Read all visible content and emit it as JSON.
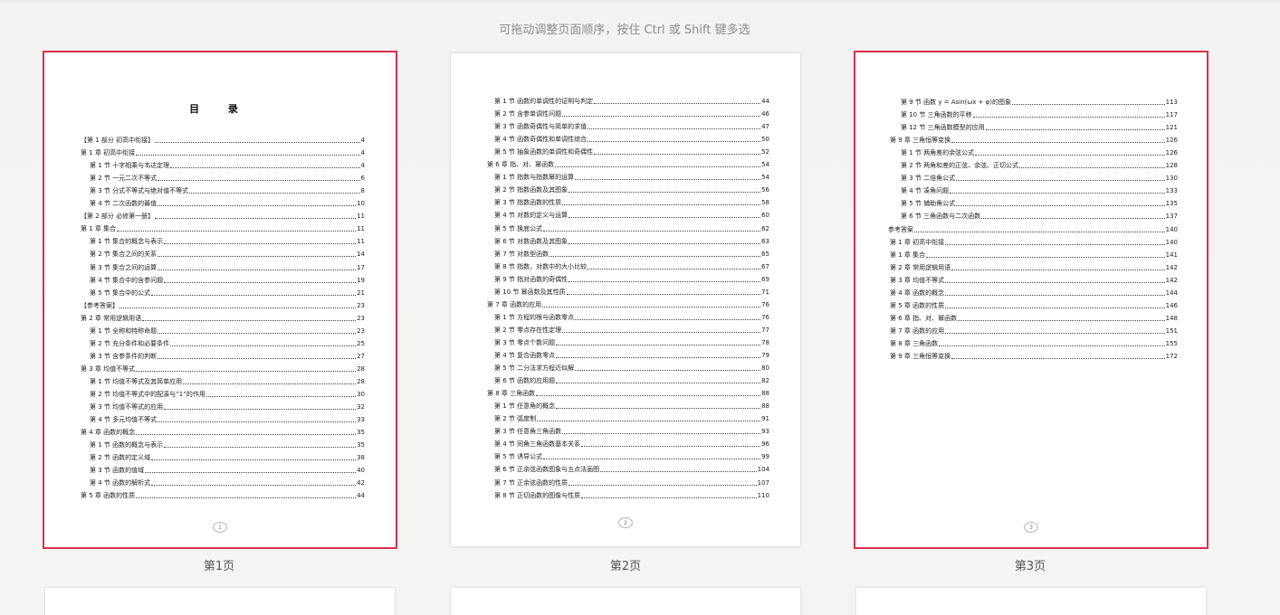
{
  "hint": "可拖动调整页面顺序，按住 Ctrl 或 Shift 键多选",
  "pages": [
    {
      "label": "第1页",
      "folio": "1",
      "title": "目 录",
      "rows": [
        {
          "t": "【第 1 部分 初高中衔接】",
          "n": "4",
          "lvl": 0
        },
        {
          "t": "第 1 章 初高中衔接",
          "n": "4",
          "lvl": 0
        },
        {
          "t": "第 1 节 十字相乘与韦达定理",
          "n": "4",
          "lvl": 1
        },
        {
          "t": "第 2 节 一元二次不等式",
          "n": "6",
          "lvl": 1
        },
        {
          "t": "第 3 节 分式不等式与绝对值不等式",
          "n": "8",
          "lvl": 1
        },
        {
          "t": "第 4 节 二次函数的最值",
          "n": "10",
          "lvl": 1
        },
        {
          "t": "【第 2 部分 必修第一册】",
          "n": "11",
          "lvl": 0
        },
        {
          "t": "第 1 章 集合",
          "n": "11",
          "lvl": 0
        },
        {
          "t": "第 1 节 集合的概念与表示",
          "n": "11",
          "lvl": 1
        },
        {
          "t": "第 2 节 集合之间的关系",
          "n": "14",
          "lvl": 1
        },
        {
          "t": "第 3 节 集合之间的运算",
          "n": "17",
          "lvl": 1
        },
        {
          "t": "第 4 节 集合中的含参问题",
          "n": "19",
          "lvl": 1
        },
        {
          "t": "第 5 节 集合中的公式",
          "n": "21",
          "lvl": 1
        },
        {
          "t": "【参考答案】",
          "n": "23",
          "lvl": 0
        },
        {
          "t": "第 2 章 常用逻辑用语",
          "n": "23",
          "lvl": 0
        },
        {
          "t": "第 1 节 全称和特称命题",
          "n": "23",
          "lvl": 1
        },
        {
          "t": "第 2 节 充分条件和必要条件",
          "n": "25",
          "lvl": 1
        },
        {
          "t": "第 3 节 含参条件的判断",
          "n": "27",
          "lvl": 1
        },
        {
          "t": "第 3 章 均值不等式",
          "n": "28",
          "lvl": 0
        },
        {
          "t": "第 1 节 均值不等式及其简单应用",
          "n": "28",
          "lvl": 1
        },
        {
          "t": "第 2 节 均值不等式中的配凑与“1”的作用",
          "n": "30",
          "lvl": 1
        },
        {
          "t": "第 3 节 均值不等式的应用",
          "n": "32",
          "lvl": 1
        },
        {
          "t": "第 4 节 多元均值不等式",
          "n": "33",
          "lvl": 1
        },
        {
          "t": "第 4 章 函数的概念",
          "n": "35",
          "lvl": 0
        },
        {
          "t": "第 1 节 函数的概念与表示",
          "n": "35",
          "lvl": 1
        },
        {
          "t": "第 2 节 函数的定义域",
          "n": "38",
          "lvl": 1
        },
        {
          "t": "第 3 节 函数的值域",
          "n": "40",
          "lvl": 1
        },
        {
          "t": "第 4 节 函数的解析式",
          "n": "42",
          "lvl": 1
        },
        {
          "t": "第 5 章 函数的性质",
          "n": "44",
          "lvl": 0
        }
      ]
    },
    {
      "label": "第2页",
      "folio": "2",
      "rows": [
        {
          "t": "第 1 节 函数的单调性的证明与判定",
          "n": "44",
          "lvl": 1
        },
        {
          "t": "第 2 节 含参单调性问题",
          "n": "46",
          "lvl": 1
        },
        {
          "t": "第 3 节 函数奇偶性与简单的求值",
          "n": "47",
          "lvl": 1
        },
        {
          "t": "第 4 节 函数奇偶性和单调性综合",
          "n": "50",
          "lvl": 1
        },
        {
          "t": "第 5 节 抽象函数的单调性和奇偶性",
          "n": "52",
          "lvl": 1
        },
        {
          "t": "第 6 章 指、对、幂函数",
          "n": "54",
          "lvl": 0
        },
        {
          "t": "第 1 节 指数与指数幂的运算",
          "n": "54",
          "lvl": 1
        },
        {
          "t": "第 2 节 指数函数及其图象",
          "n": "56",
          "lvl": 1
        },
        {
          "t": "第 3 节 指数函数的性质",
          "n": "58",
          "lvl": 1
        },
        {
          "t": "第 4 节 对数的定义与运算",
          "n": "60",
          "lvl": 1
        },
        {
          "t": "第 5 节 换底公式",
          "n": "62",
          "lvl": 1
        },
        {
          "t": "第 6 节 对数函数及其图象",
          "n": "63",
          "lvl": 1
        },
        {
          "t": "第 7 节 对数型函数",
          "n": "65",
          "lvl": 1
        },
        {
          "t": "第 8 节 指数、对数中的大小比较",
          "n": "67",
          "lvl": 1
        },
        {
          "t": "第 9 节 指对函数的奇偶性",
          "n": "69",
          "lvl": 1
        },
        {
          "t": "第 10 节 幂函数及其性质",
          "n": "71",
          "lvl": 1
        },
        {
          "t": "第 7 章 函数的应用",
          "n": "76",
          "lvl": 0
        },
        {
          "t": "第 1 节 方程的根与函数零点",
          "n": "76",
          "lvl": 1
        },
        {
          "t": "第 2 节 零点存在性定理",
          "n": "77",
          "lvl": 1
        },
        {
          "t": "第 3 节 零点个数问题",
          "n": "78",
          "lvl": 1
        },
        {
          "t": "第 4 节 复合函数零点",
          "n": "79",
          "lvl": 1
        },
        {
          "t": "第 5 节 二分法求方程近似解",
          "n": "80",
          "lvl": 1
        },
        {
          "t": "第 6 节 函数的应用题",
          "n": "82",
          "lvl": 1
        },
        {
          "t": "第 8 章 三角函数",
          "n": "88",
          "lvl": 0
        },
        {
          "t": "第 1 节 任意角的概念",
          "n": "88",
          "lvl": 1
        },
        {
          "t": "第 2 节 弧度制",
          "n": "91",
          "lvl": 1
        },
        {
          "t": "第 3 节 任意角三角函数",
          "n": "93",
          "lvl": 1
        },
        {
          "t": "第 4 节 同角三角函数基本关系",
          "n": "96",
          "lvl": 1
        },
        {
          "t": "第 5 节 诱导公式",
          "n": "99",
          "lvl": 1
        },
        {
          "t": "第 6 节 正余弦函数图象与五点法画图",
          "n": "104",
          "lvl": 1
        },
        {
          "t": "第 7 节 正余弦函数的性质",
          "n": "107",
          "lvl": 1
        },
        {
          "t": "第 8 节 正切函数的图像与性质",
          "n": "110",
          "lvl": 1
        }
      ]
    },
    {
      "label": "第3页",
      "folio": "3",
      "rows": [
        {
          "t": "第 9 节 函数 y = Asin(ωx + φ)的图象",
          "n": "113",
          "lvl": 1
        },
        {
          "t": "第 10 节 三角函数的平移",
          "n": "117",
          "lvl": 1
        },
        {
          "t": "第 12 节 三角函数模型的应用",
          "n": "121",
          "lvl": 1
        },
        {
          "t": "第 9 章 三角恒等变换",
          "n": "126",
          "lvl": 0
        },
        {
          "t": "第 1 节 两角差的余弦公式",
          "n": "126",
          "lvl": 1
        },
        {
          "t": "第 2 节 两角和差的正弦、余弦、正切公式",
          "n": "128",
          "lvl": 1
        },
        {
          "t": "第 3 节 二倍角公式",
          "n": "130",
          "lvl": 1
        },
        {
          "t": "第 4 节 凑角问题",
          "n": "133",
          "lvl": 1
        },
        {
          "t": "第 5 节 辅助角公式",
          "n": "135",
          "lvl": 1
        },
        {
          "t": "第 6 节 三角函数与二次函数",
          "n": "137",
          "lvl": 1
        },
        {
          "t": "参考答案",
          "n": "140",
          "lvl": -1
        },
        {
          "t": "第 1 章 初高中衔接",
          "n": "140",
          "lvl": 0
        },
        {
          "t": "第 1 章 集合",
          "n": "141",
          "lvl": 0
        },
        {
          "t": "第 2 章 常用逻辑用语",
          "n": "142",
          "lvl": 0
        },
        {
          "t": "第 3 章 均值不等式",
          "n": "142",
          "lvl": 0
        },
        {
          "t": "第 4 章 函数的概念",
          "n": "144",
          "lvl": 0
        },
        {
          "t": "第 5 章 函数的性质",
          "n": "146",
          "lvl": 0
        },
        {
          "t": "第 6 章 指、对、幂函数",
          "n": "148",
          "lvl": 0
        },
        {
          "t": "第 7 章 函数的应用",
          "n": "151",
          "lvl": 0
        },
        {
          "t": "第 8 章 三角函数",
          "n": "155",
          "lvl": 0
        },
        {
          "t": "第 9 章 三角恒等变换",
          "n": "172",
          "lvl": 0
        }
      ]
    }
  ],
  "colors": {
    "selected_border": "#d9304f",
    "background": "#f3f3f1"
  }
}
